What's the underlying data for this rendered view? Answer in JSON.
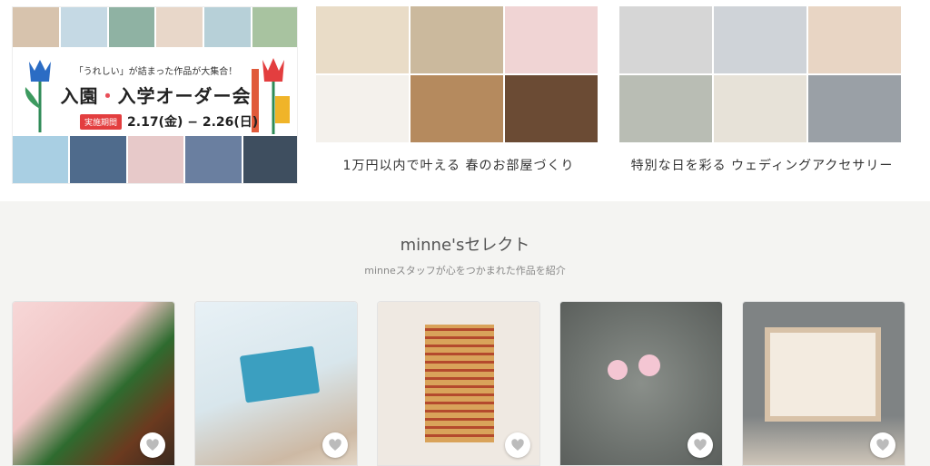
{
  "banner": {
    "subtitle": "「うれしい」が詰まった作品が大集合！",
    "title_part1": "入園",
    "title_dot": "・",
    "title_part2": "入学オーダー会",
    "period_label": "実施期間",
    "period_dates": "2.17(金) − 2.26(日)"
  },
  "features": [
    {
      "caption": "1万円以内で叶える 春のお部屋づくり"
    },
    {
      "caption": "特別な日を彩る ウェディングアクセサリー"
    }
  ],
  "select": {
    "title": "minne'sセレクト",
    "subtitle": "minneスタッフが心をつかまれた作品を紹介"
  },
  "icons": {
    "heart": "heart-icon"
  }
}
